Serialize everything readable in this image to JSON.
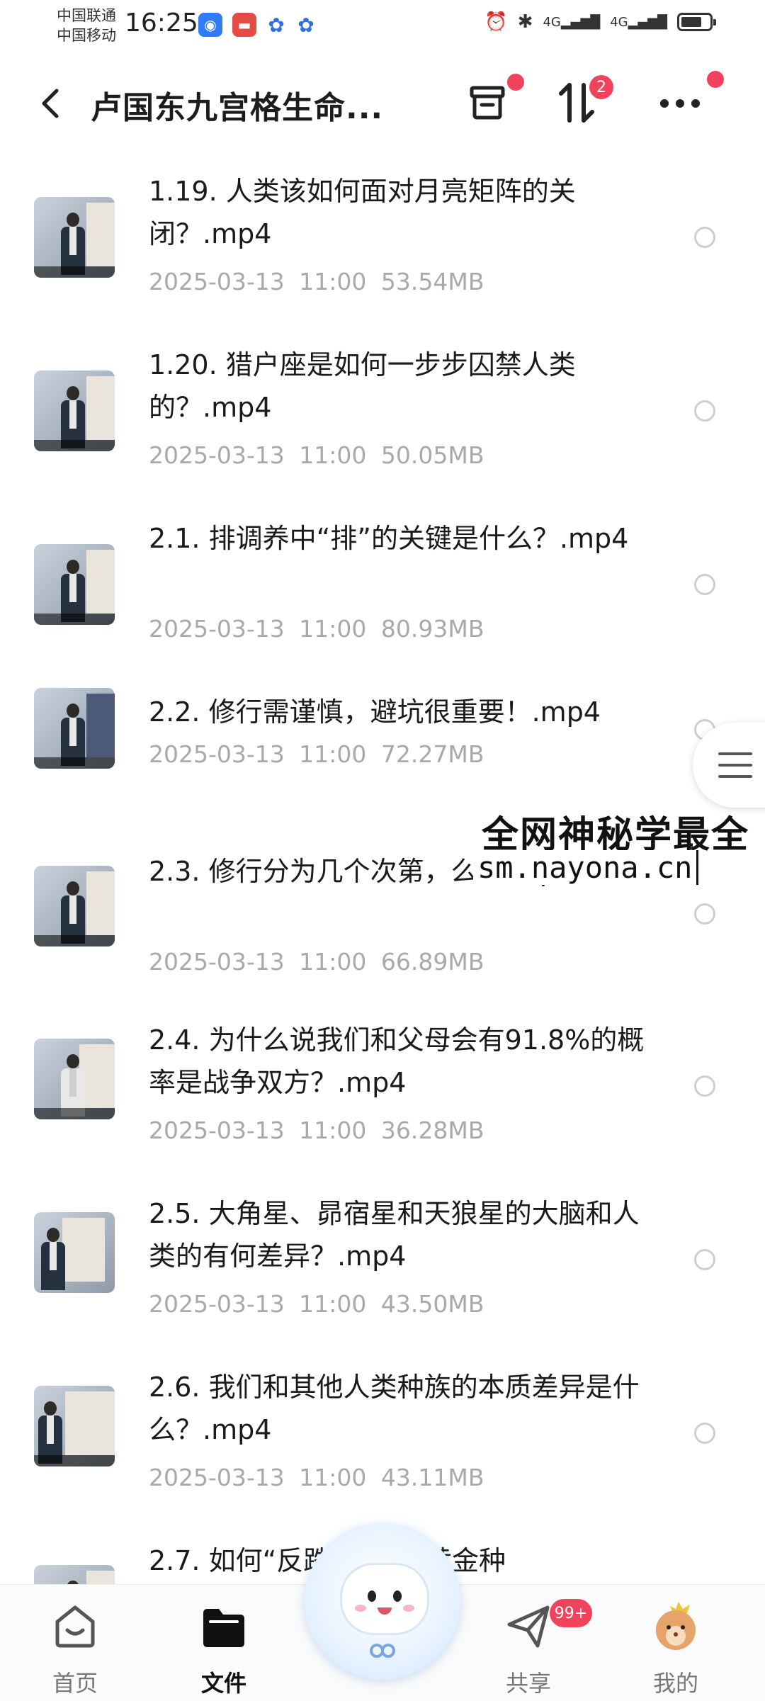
{
  "status_bar": {
    "carrier1": "中国联通",
    "carrier2": "中国移动",
    "time": "16:25",
    "network1": "4G",
    "network2": "4G"
  },
  "header": {
    "title": "卢国东九宫格生命...",
    "sort_badge": "2"
  },
  "files": [
    {
      "name": "1.19. 人类该如何面对月亮矩阵的关闭？.mp4",
      "date": "2025-03-13",
      "time": "11:00",
      "size": "53.54MB"
    },
    {
      "name": "1.20. 猎户座是如何一步步囚禁人类的？.mp4",
      "date": "2025-03-13",
      "time": "11:00",
      "size": "50.05MB"
    },
    {
      "name": "2.1. 排调养中“排”的关键是什么？.mp4",
      "date": "2025-03-13",
      "time": "11:00",
      "size": "80.93MB"
    },
    {
      "name": "2.2. 修行需谨慎，避坑很重要！.mp4",
      "date": "2025-03-13",
      "time": "11:00",
      "size": "72.27MB"
    },
    {
      "name": "2.3. 修行分为几个次第，么？.mp4",
      "date": "2025-03-13",
      "time": "11:00",
      "size": "66.89MB"
    },
    {
      "name": "2.4. 为什么说我们和父母会有91.8%的概率是战争双方？.mp4",
      "date": "2025-03-13",
      "time": "11:00",
      "size": "36.28MB"
    },
    {
      "name": "2.5. 大角星、昴宿星和天狼星的大脑和人类的有何差异？.mp4",
      "date": "2025-03-13",
      "time": "11:00",
      "size": "43.50MB"
    },
    {
      "name": "2.6. 我们和其他人类种族的本质差异是什么？.mp4",
      "date": "2025-03-13",
      "time": "11:00",
      "size": "43.11MB"
    },
    {
      "name": "2.7. 如何“反跌落”修到黄金种",
      "date": "",
      "time": "",
      "size": ""
    }
  ],
  "watermark": {
    "line1": "全网神秘学最全",
    "line2": "sm.nayona.cn"
  },
  "bottom_nav": {
    "home": "首页",
    "files": "文件",
    "share": "共享",
    "share_badge": "99+",
    "mine": "我的"
  },
  "colors": {
    "accent_red": "#f2435e",
    "meta_gray": "#a9a9a9"
  }
}
